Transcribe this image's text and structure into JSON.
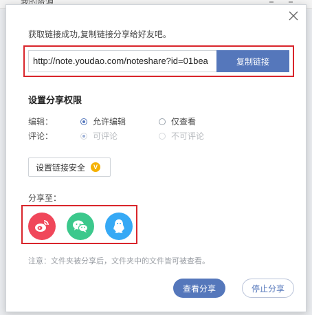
{
  "background": {
    "window_title": "我的资源"
  },
  "dialog": {
    "message": "获取链接成功,复制链接分享给好友吧。",
    "link": {
      "value": "http://note.youdao.com/noteshare?id=01bea",
      "copy_label": "复制链接"
    },
    "permissions": {
      "title": "设置分享权限",
      "edit": {
        "label": "编辑：",
        "options": [
          "允许编辑",
          "仅查看"
        ],
        "selected": "允许编辑"
      },
      "comment": {
        "label": "评论：",
        "options": [
          "可评论",
          "不可评论"
        ],
        "selected": "可评论",
        "disabled": true
      }
    },
    "security_button": {
      "label": "设置链接安全",
      "badge": "V"
    },
    "share": {
      "label": "分享至：",
      "targets": [
        {
          "name": "weibo-icon",
          "color": "#f0475a"
        },
        {
          "name": "wechat-icon",
          "color": "#3cc88c"
        },
        {
          "name": "qq-icon",
          "color": "#36a9f5"
        }
      ]
    },
    "note": "注意：文件夹被分享后，文件夹中的文件皆可被查看。",
    "actions": {
      "view_label": "查看分享",
      "stop_label": "停止分享"
    }
  },
  "colors": {
    "accent": "#5577bb",
    "highlight_box": "#d9252b"
  }
}
